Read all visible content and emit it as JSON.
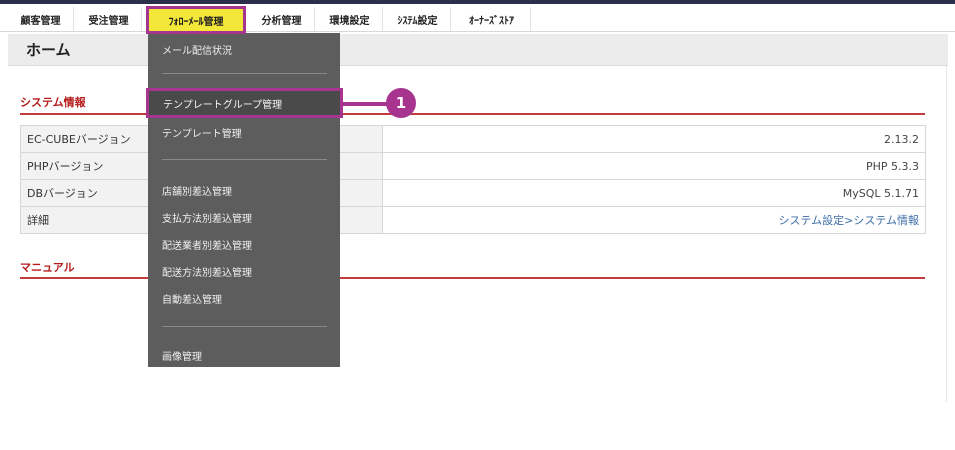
{
  "nav": {
    "items": [
      {
        "label": "顧客管理"
      },
      {
        "label": "受注管理"
      },
      {
        "label": "ﾌｫﾛｰﾒｰﾙ管理"
      },
      {
        "label": "分析管理"
      },
      {
        "label": "環境設定"
      },
      {
        "label": "ｼｽﾃﾑ設定"
      },
      {
        "label": "ｵｰﾅｰｽﾞｽﾄｱ"
      }
    ]
  },
  "page": {
    "title": "ホーム"
  },
  "sections": {
    "system_info": "システム情報",
    "manual": "マニュアル"
  },
  "system_table": {
    "rows": [
      {
        "label": "EC-CUBEバージョン",
        "value": "2.13.2"
      },
      {
        "label": "PHPバージョン",
        "value": "PHP 5.3.3"
      },
      {
        "label": "DBバージョン",
        "value": "MySQL 5.1.71"
      },
      {
        "label": "詳細",
        "value": "システム設定>システム情報"
      }
    ]
  },
  "dropdown": {
    "items": [
      {
        "label": "メール配信状況"
      },
      {
        "label": "テンプレートグループ管理"
      },
      {
        "label": "テンプレート管理"
      },
      {
        "label": "店舗別差込管理"
      },
      {
        "label": "支払方法別差込管理"
      },
      {
        "label": "配送業者別差込管理"
      },
      {
        "label": "配送方法別差込管理"
      },
      {
        "label": "自動差込管理"
      },
      {
        "label": "画像管理"
      }
    ]
  },
  "callout": {
    "number": "1"
  },
  "colors": {
    "accent_magenta": "#a7348f",
    "active_nav_bg": "#f3e73a",
    "section_red": "#b51a1a",
    "dropdown_bg": "#5d5d5d",
    "link_blue": "#3f6ea8"
  }
}
